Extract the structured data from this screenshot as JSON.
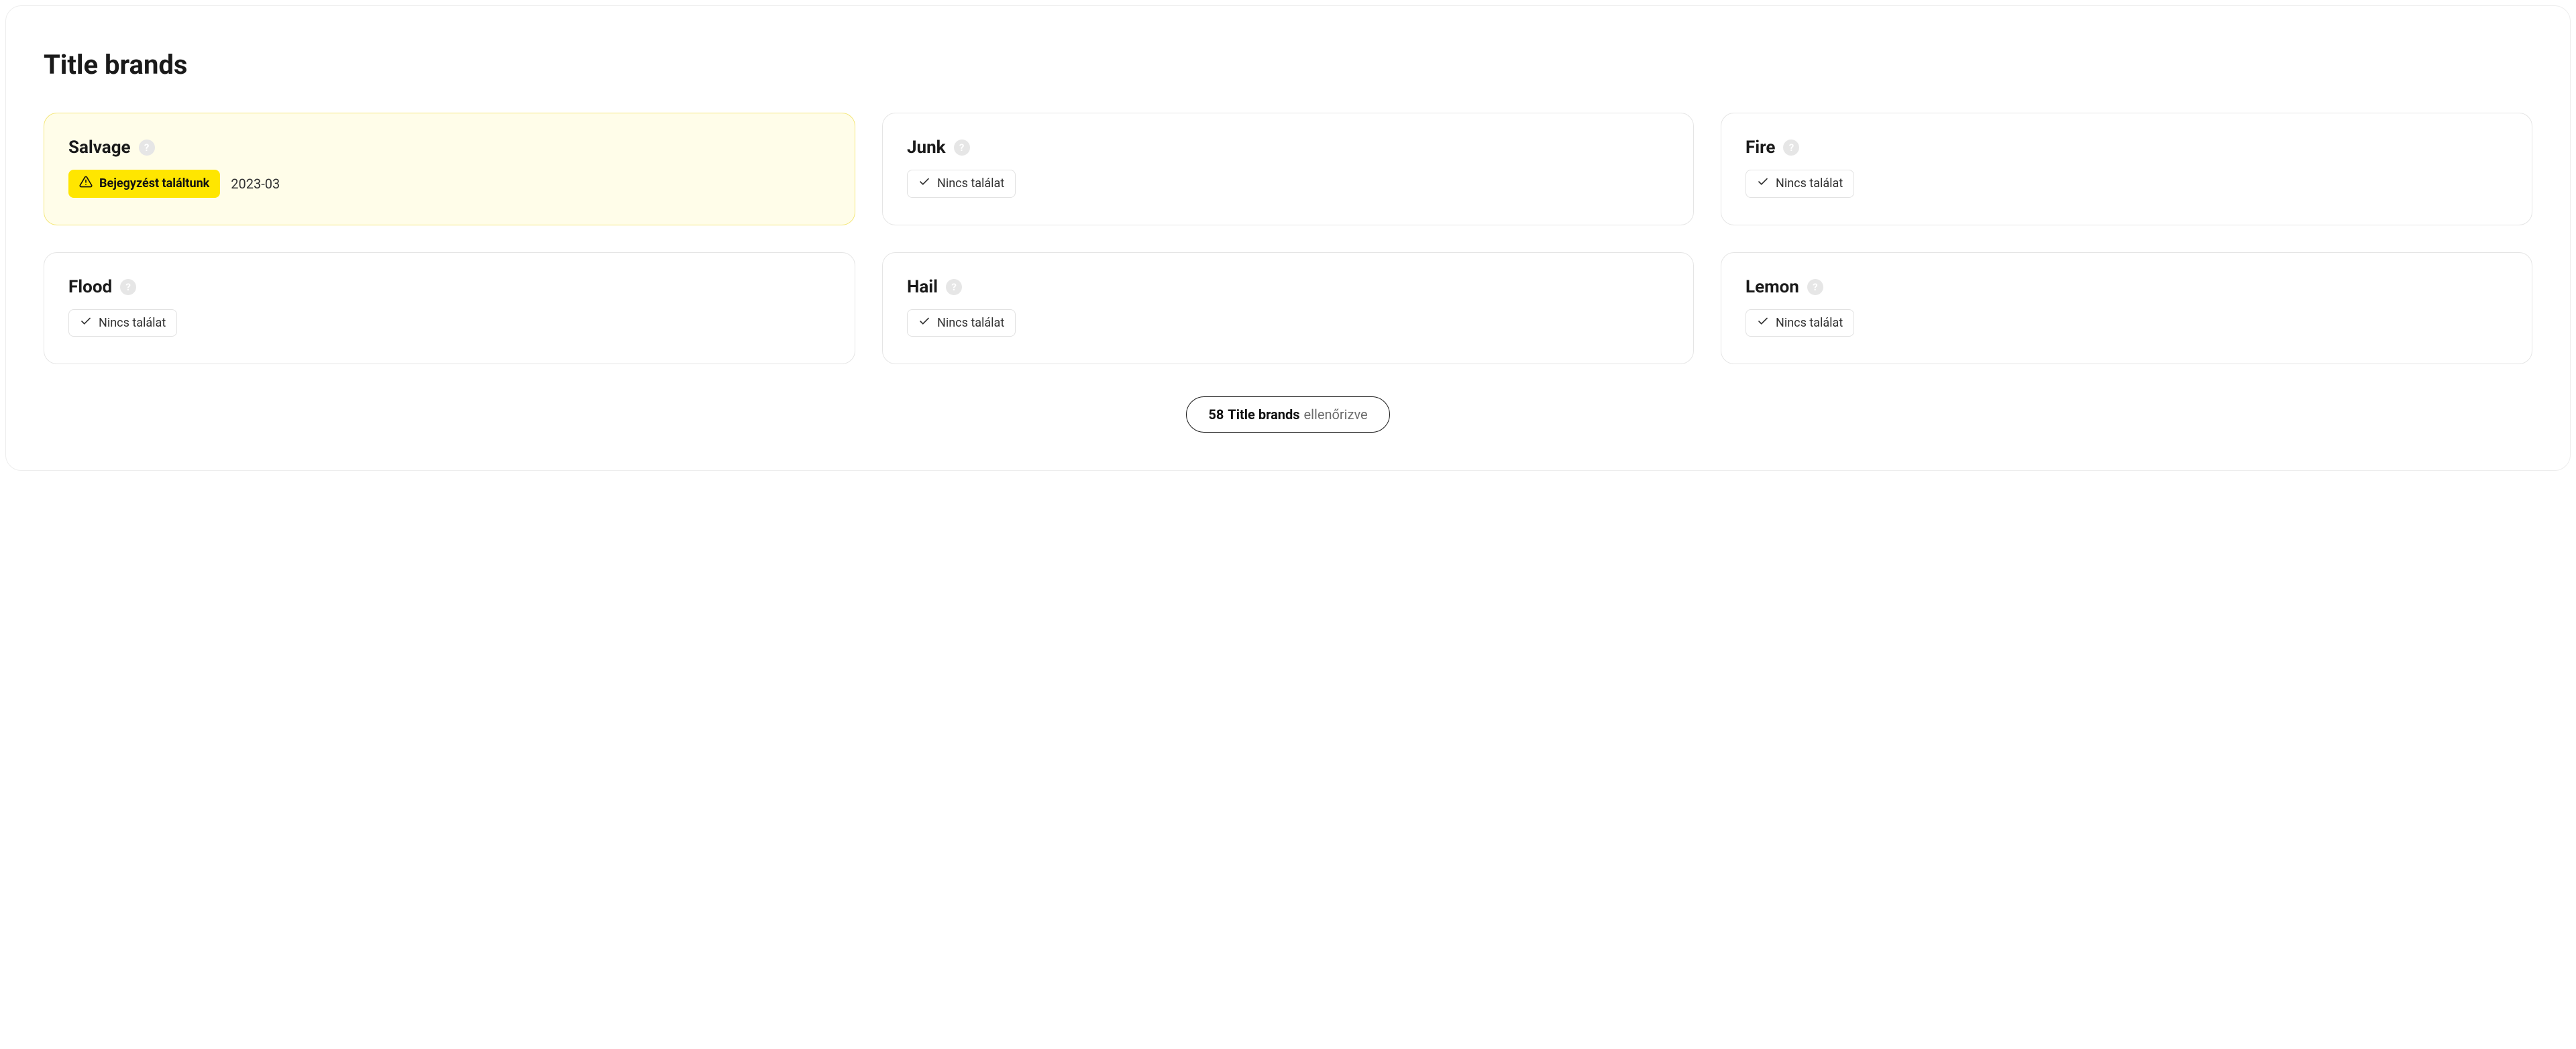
{
  "section": {
    "title": "Title brands"
  },
  "cards": [
    {
      "title": "Salvage",
      "highlighted": true,
      "status_type": "warning",
      "status_text": "Bejegyzést találtunk",
      "date": "2023-03"
    },
    {
      "title": "Junk",
      "highlighted": false,
      "status_type": "neutral",
      "status_text": "Nincs találat",
      "date": null
    },
    {
      "title": "Fire",
      "highlighted": false,
      "status_type": "neutral",
      "status_text": "Nincs találat",
      "date": null
    },
    {
      "title": "Flood",
      "highlighted": false,
      "status_type": "neutral",
      "status_text": "Nincs találat",
      "date": null
    },
    {
      "title": "Hail",
      "highlighted": false,
      "status_type": "neutral",
      "status_text": "Nincs találat",
      "date": null
    },
    {
      "title": "Lemon",
      "highlighted": false,
      "status_type": "neutral",
      "status_text": "Nincs találat",
      "date": null
    }
  ],
  "summary": {
    "count": "58",
    "label": "Title brands",
    "suffix": "ellenőrizve"
  },
  "icons": {
    "help_glyph": "?"
  }
}
